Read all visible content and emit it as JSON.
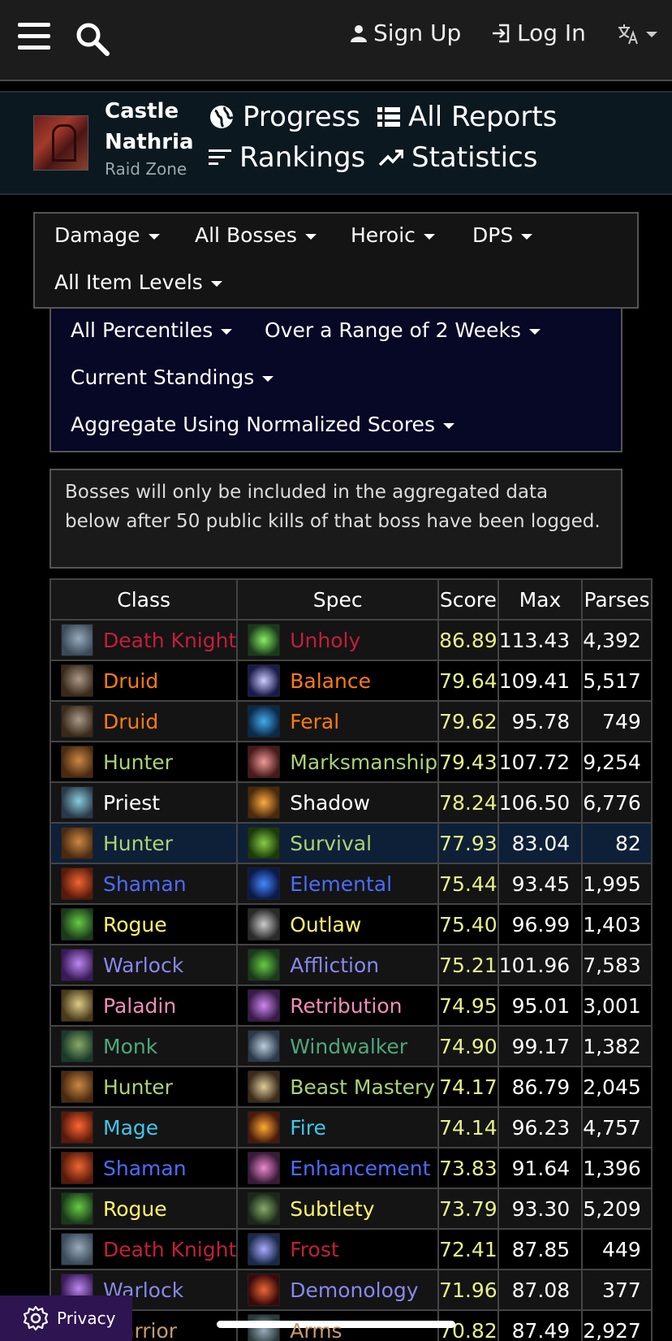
{
  "topbar": {
    "signup": "Sign Up",
    "login": "Log In"
  },
  "zone": {
    "title_line1": "Castle",
    "title_line2": "Nathria",
    "subtitle": "Raid Zone",
    "nav": [
      "Progress",
      "All Reports",
      "Rankings",
      "Statistics"
    ]
  },
  "filters": {
    "metric": "Damage",
    "boss": "All Bosses",
    "difficulty": "Heroic",
    "role": "DPS",
    "item_levels": "All Item Levels",
    "percentiles": "All Percentiles",
    "range": "Over a Range of 2 Weeks",
    "standings": "Current Standings",
    "aggregate": "Aggregate Using Normalized Scores"
  },
  "notice": "Bosses will only be included in the aggregated data below after 50 public kills of that boss have been logged.",
  "table": {
    "headers": [
      "Class",
      "Spec",
      "Score",
      "Max",
      "Parses"
    ],
    "rows": [
      {
        "class": "Death Knight",
        "spec": "Unholy",
        "score": "86.89",
        "max": "113.43",
        "parses": "4,392",
        "color": "#c41e3a",
        "icon": "death-knight-icon",
        "spec_icon": "unholy-icon"
      },
      {
        "class": "Druid",
        "spec": "Balance",
        "score": "79.64",
        "max": "109.41",
        "parses": "5,517",
        "color": "#ff7c0a",
        "icon": "druid-icon",
        "spec_icon": "balance-icon"
      },
      {
        "class": "Druid",
        "spec": "Feral",
        "score": "79.62",
        "max": "95.78",
        "parses": "749",
        "color": "#ff7c0a",
        "icon": "druid-icon",
        "spec_icon": "feral-icon"
      },
      {
        "class": "Hunter",
        "spec": "Marksmanship",
        "score": "79.43",
        "max": "107.72",
        "parses": "9,254",
        "color": "#aad372",
        "icon": "hunter-icon",
        "spec_icon": "marksmanship-icon"
      },
      {
        "class": "Priest",
        "spec": "Shadow",
        "score": "78.24",
        "max": "106.50",
        "parses": "6,776",
        "color": "#ffffff",
        "icon": "priest-icon",
        "spec_icon": "shadow-icon"
      },
      {
        "class": "Hunter",
        "spec": "Survival",
        "score": "77.93",
        "max": "83.04",
        "parses": "82",
        "color": "#aad372",
        "icon": "hunter-icon",
        "spec_icon": "survival-icon",
        "highlight": true
      },
      {
        "class": "Shaman",
        "spec": "Elemental",
        "score": "75.44",
        "max": "93.45",
        "parses": "1,995",
        "color": "#4a6cff",
        "icon": "shaman-icon",
        "spec_icon": "elemental-icon"
      },
      {
        "class": "Rogue",
        "spec": "Outlaw",
        "score": "75.40",
        "max": "96.99",
        "parses": "1,403",
        "color": "#fff468",
        "icon": "rogue-icon",
        "spec_icon": "outlaw-icon"
      },
      {
        "class": "Warlock",
        "spec": "Affliction",
        "score": "75.21",
        "max": "101.96",
        "parses": "7,583",
        "color": "#8788ee",
        "icon": "warlock-icon",
        "spec_icon": "affliction-icon"
      },
      {
        "class": "Paladin",
        "spec": "Retribution",
        "score": "74.95",
        "max": "95.01",
        "parses": "3,001",
        "color": "#f48cba",
        "icon": "paladin-icon",
        "spec_icon": "retribution-icon"
      },
      {
        "class": "Monk",
        "spec": "Windwalker",
        "score": "74.90",
        "max": "99.17",
        "parses": "1,382",
        "color": "#4fa87a",
        "icon": "monk-icon",
        "spec_icon": "windwalker-icon"
      },
      {
        "class": "Hunter",
        "spec": "Beast Mastery",
        "score": "74.17",
        "max": "86.79",
        "parses": "2,045",
        "color": "#aad372",
        "icon": "hunter-icon",
        "spec_icon": "beast-mastery-icon"
      },
      {
        "class": "Mage",
        "spec": "Fire",
        "score": "74.14",
        "max": "96.23",
        "parses": "4,757",
        "color": "#3fc7eb",
        "icon": "mage-icon",
        "spec_icon": "fire-icon"
      },
      {
        "class": "Shaman",
        "spec": "Enhancement",
        "score": "73.83",
        "max": "91.64",
        "parses": "1,396",
        "color": "#4a6cff",
        "icon": "shaman-icon",
        "spec_icon": "enhancement-icon"
      },
      {
        "class": "Rogue",
        "spec": "Subtlety",
        "score": "73.79",
        "max": "93.30",
        "parses": "5,209",
        "color": "#fff468",
        "icon": "rogue-icon",
        "spec_icon": "subtlety-icon"
      },
      {
        "class": "Death Knight",
        "spec": "Frost",
        "score": "72.41",
        "max": "87.85",
        "parses": "449",
        "color": "#c41e3a",
        "icon": "death-knight-icon",
        "spec_icon": "frost-icon"
      },
      {
        "class": "Warlock",
        "spec": "Demonology",
        "score": "71.96",
        "max": "87.08",
        "parses": "377",
        "color": "#8788ee",
        "icon": "warlock-icon",
        "spec_icon": "demonology-icon"
      },
      {
        "class": "Warrior",
        "spec": "Arms",
        "score": "70.82",
        "max": "87.49",
        "parses": "2,927",
        "color": "#c69b6d",
        "icon": "warrior-icon",
        "spec_icon": "arms-icon"
      }
    ]
  },
  "privacy": "Privacy",
  "colors": {
    "score": "#e8f087",
    "highlight_row": "#0e2038",
    "zonebar": "#0b1820",
    "filter_box": "#070726",
    "privacy_bg": "#2e1450"
  }
}
